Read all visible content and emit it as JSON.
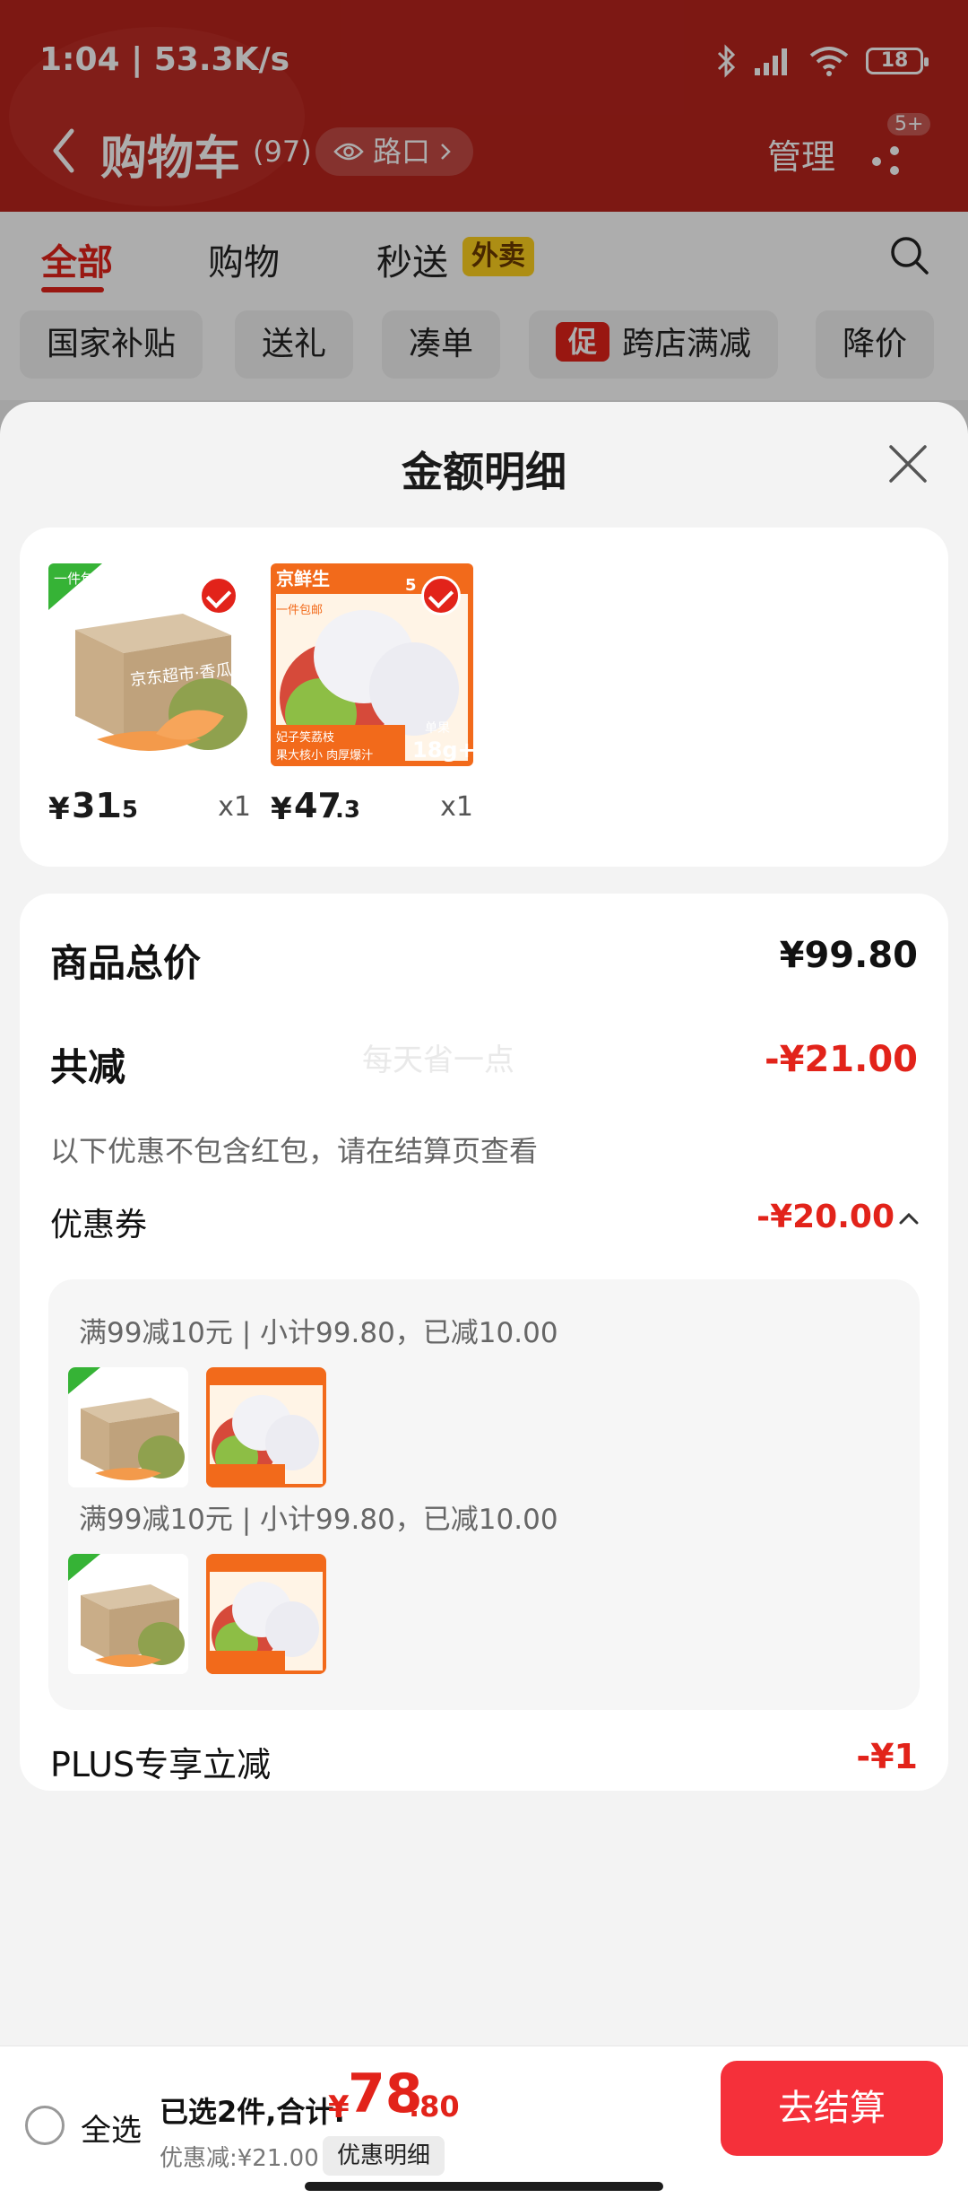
{
  "status_bar": {
    "time": "1:04 | 53.3K/s",
    "battery": "18"
  },
  "header": {
    "title": "购物车",
    "count": "(97)",
    "location": "路口",
    "manage": "管理",
    "more_badge": "5+"
  },
  "tabs": {
    "all": "全部",
    "shopping": "购物",
    "instant": "秒送",
    "waimai": "外卖"
  },
  "chips": [
    "国家补贴",
    "送礼",
    "凑单",
    "跨店满减",
    "降价"
  ],
  "promo_mark": "促",
  "sheet": {
    "title": "金额明细",
    "products": [
      {
        "currency": "¥",
        "price_int": "31",
        "price_dec": ".5",
        "qty": "x1",
        "ribbon": "一件包邮",
        "box_text": "京东超市·香瓜"
      },
      {
        "currency": "¥",
        "price_int": "47",
        "price_dec": ".3",
        "qty": "x1",
        "brand": "京鲜生",
        "tag": "一件包邮",
        "badge": "5",
        "sub1": "妃子笑荔枝",
        "sub2": "果大核小 肉厚爆汁",
        "spec_top": "单果",
        "spec": "18g+"
      }
    ],
    "summary": {
      "total_label": "商品总价",
      "total_value": "¥99.80",
      "reduce_label": "共减",
      "reduce_value": "-¥21.00",
      "watermark": "每天省一点",
      "note": "以下优惠不包含红包，请在结算页查看",
      "coupon_label": "优惠券",
      "coupon_value": "-¥20.00",
      "coupon_lines": [
        "满99减10元 | 小计99.80，已减10.00",
        "满99减10元 | 小计99.80，已减10.00"
      ],
      "plus_label": "PLUS专享立减",
      "plus_value": "-¥1"
    }
  },
  "bottom": {
    "select_all": "全选",
    "selected": "已选2件,合计:",
    "currency": "¥",
    "total_int": "78",
    "total_dec": ".80",
    "discount": "优惠减:¥21.00",
    "detail": "优惠明细",
    "checkout": "去结算"
  },
  "colors": {
    "brand_red": "#e2231a",
    "header_red": "#b8241d",
    "checkout": "#f5303a"
  }
}
